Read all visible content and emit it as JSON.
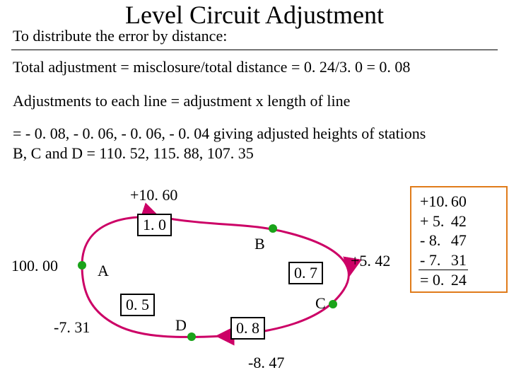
{
  "title": "Level Circuit Adjustment",
  "subtitle": "To distribute the error by distance:",
  "eq_total": "Total adjustment = misclosure/total distance = 0. 24/3. 0 = 0. 08",
  "eq_line": "Adjustments to each line = adjustment x length of line",
  "eq_result": "= - 0. 08, - 0. 06, - 0. 06, - 0. 04 giving adjusted heights of stations B, C and D = 110. 52, 115. 88, 107. 35",
  "labels": {
    "A": "A",
    "B": "B",
    "C": "C",
    "D": "D",
    "start": "100. 00",
    "dAB": "+10. 60",
    "dBC": "+5. 42",
    "dCD": "-8. 47",
    "dDA": "-7. 31",
    "lenAB": "1. 0",
    "lenBC": "0. 7",
    "lenCD": "0. 8",
    "lenDA": "0. 5"
  },
  "sum": {
    "r1a": "+10.",
    "r1b": "60",
    "r2a": "+  5.",
    "r2b": "42",
    "r3a": " -  8.",
    "r3b": "47",
    "r4a": " -  7.",
    "r4b": "31",
    "r5a": "=  0.",
    "r5b": "24"
  },
  "chart_data": {
    "type": "diagram",
    "title": "Level Circuit Adjustment",
    "nodes": [
      {
        "id": "A",
        "height_start": 100.0
      },
      {
        "id": "B",
        "adjusted_height": 110.52
      },
      {
        "id": "C",
        "adjusted_height": 115.88
      },
      {
        "id": "D",
        "adjusted_height": 107.35
      }
    ],
    "edges": [
      {
        "from": "A",
        "to": "B",
        "delta_h": 10.6,
        "length": 1.0,
        "adjustment": -0.08
      },
      {
        "from": "B",
        "to": "C",
        "delta_h": 5.42,
        "length": 0.7,
        "adjustment": -0.06
      },
      {
        "from": "C",
        "to": "D",
        "delta_h": -8.47,
        "length": 0.8,
        "adjustment": -0.06
      },
      {
        "from": "D",
        "to": "A",
        "delta_h": -7.31,
        "length": 0.5,
        "adjustment": -0.04
      }
    ],
    "total_distance": 3.0,
    "misclosure": 0.24,
    "unit_adjustment": 0.08,
    "misclosure_sum": [
      10.6,
      5.42,
      -8.47,
      -7.31
    ]
  }
}
